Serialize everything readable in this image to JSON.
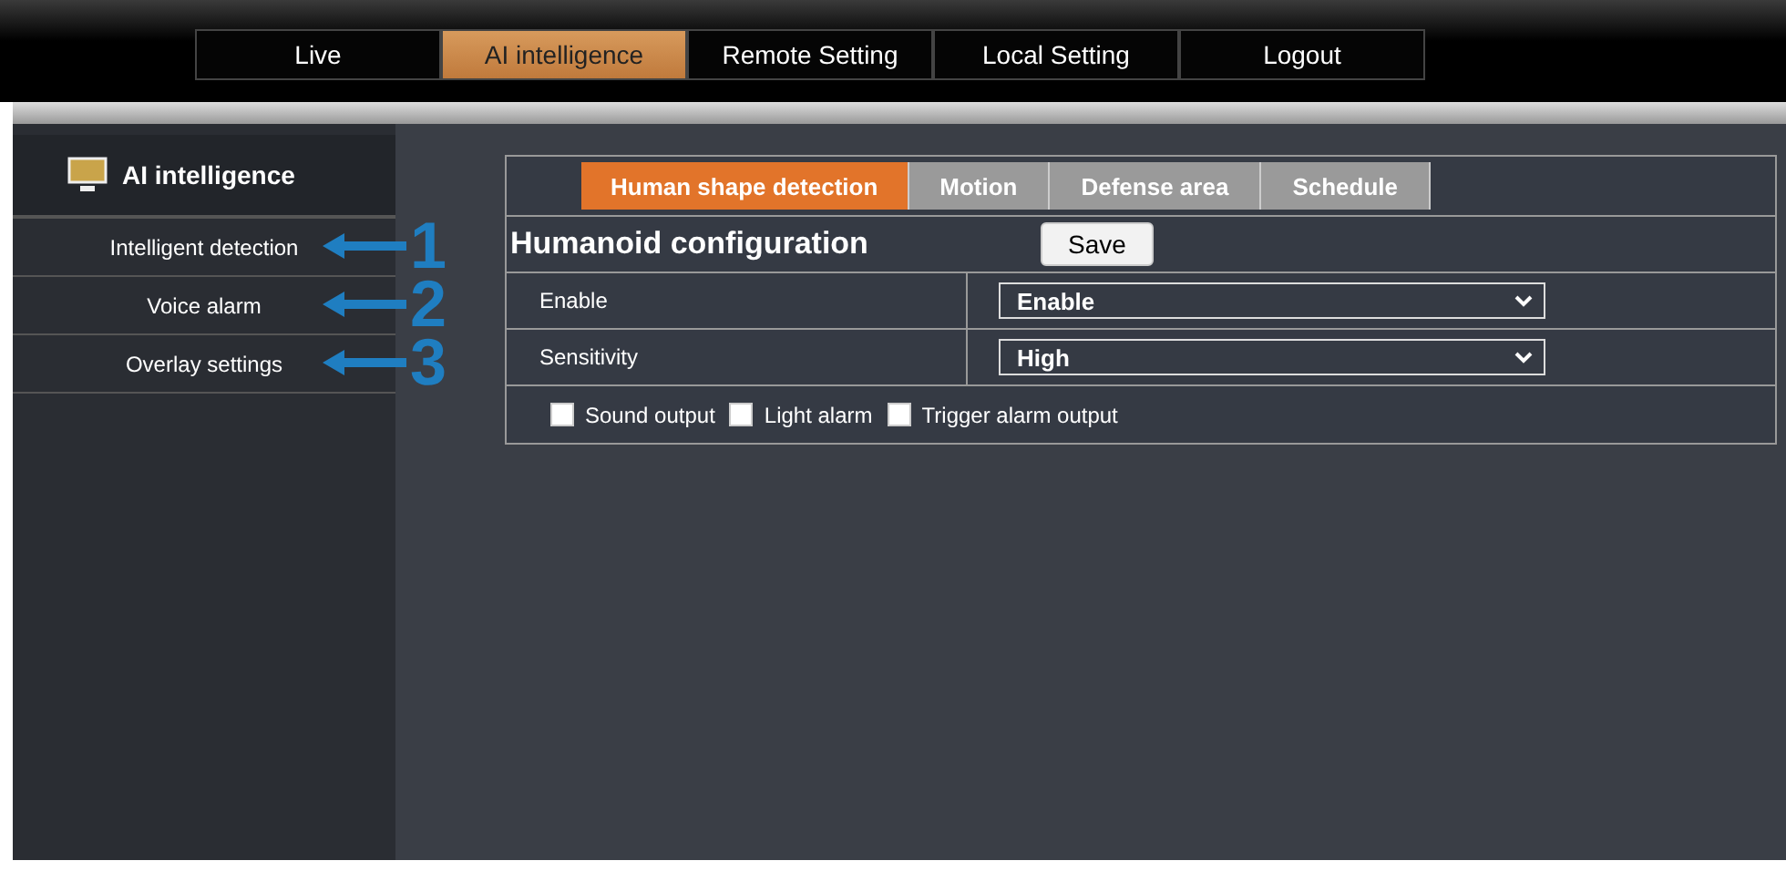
{
  "nav": [
    {
      "label": "Live",
      "selected": false
    },
    {
      "label": "AI intelligence",
      "selected": true
    },
    {
      "label": "Remote Setting",
      "selected": false
    },
    {
      "label": "Local Setting",
      "selected": false
    },
    {
      "label": "Logout",
      "selected": false
    }
  ],
  "sidebar": {
    "title": "AI intelligence",
    "items": [
      {
        "label": "Intelligent detection",
        "callout": "1"
      },
      {
        "label": "Voice alarm",
        "callout": "2"
      },
      {
        "label": "Overlay settings",
        "callout": "3"
      }
    ]
  },
  "tabs": [
    {
      "label": "Human shape detection",
      "selected": true
    },
    {
      "label": "Motion",
      "selected": false
    },
    {
      "label": "Defense area",
      "selected": false
    },
    {
      "label": "Schedule",
      "selected": false
    }
  ],
  "section_title": "Humanoid configuration",
  "save_button": "Save",
  "fields": [
    {
      "label": "Enable",
      "value": "Enable"
    },
    {
      "label": "Sensitivity",
      "value": "High"
    }
  ],
  "options": [
    {
      "label": "Sound output",
      "checked": false
    },
    {
      "label": "Light alarm",
      "checked": false
    },
    {
      "label": "Trigger alarm output",
      "checked": false
    }
  ]
}
